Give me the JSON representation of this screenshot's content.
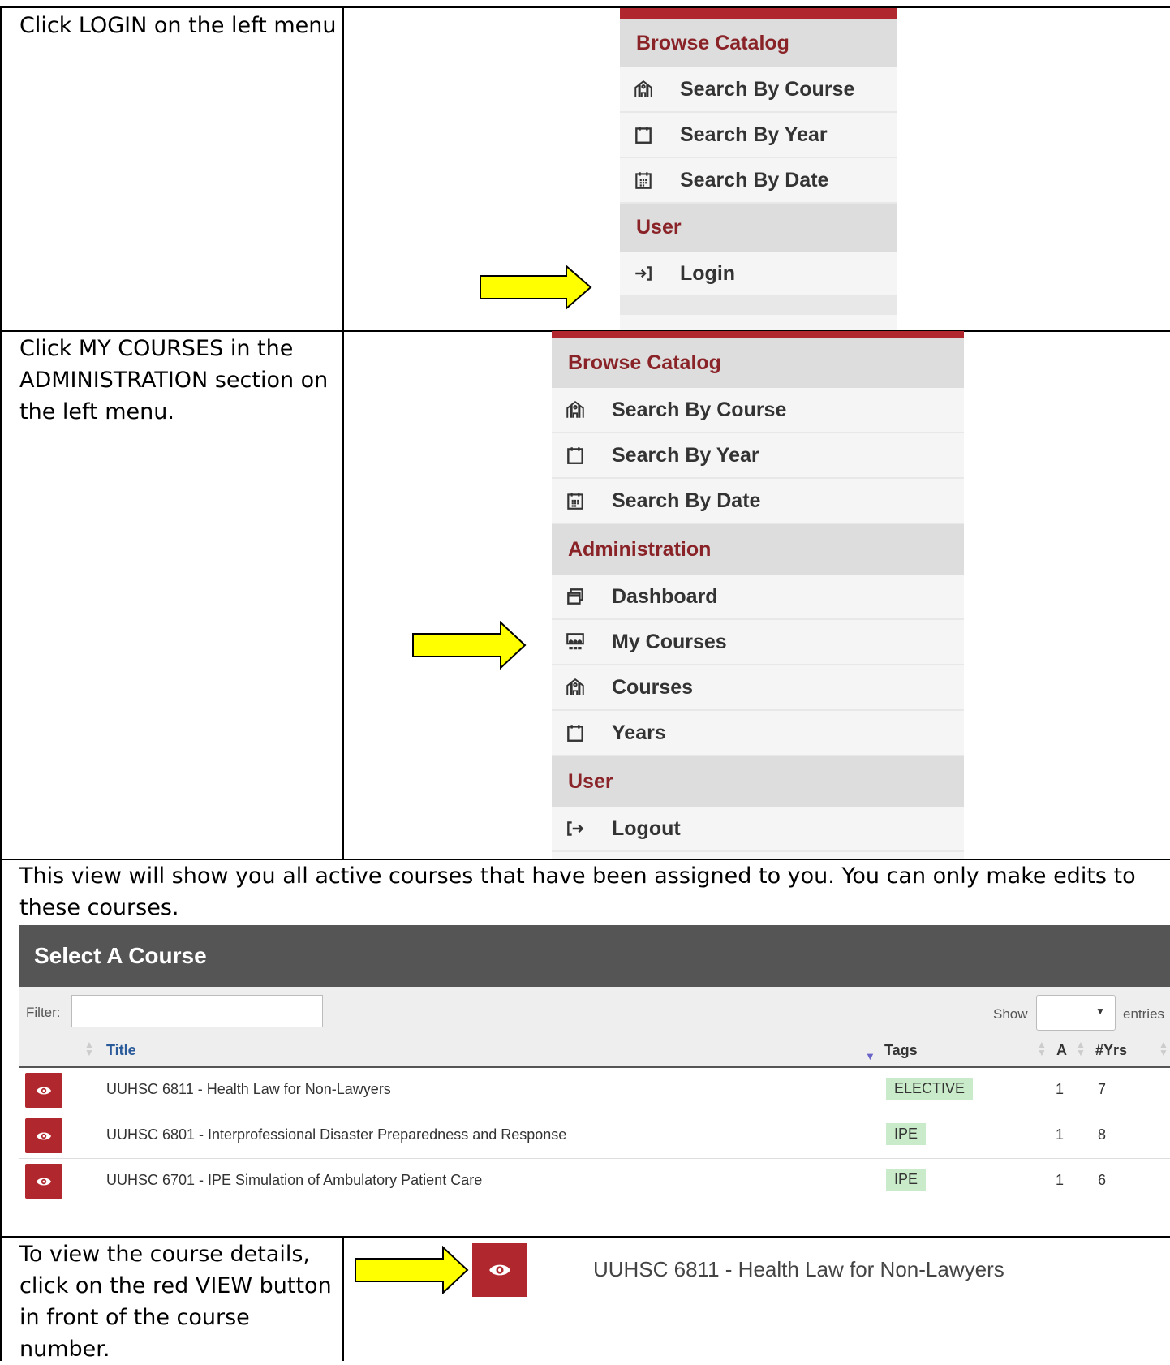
{
  "rows": [
    {
      "instruction": "Click LOGIN on the left menu"
    },
    {
      "instruction": "Click MY COURSES in the ADMINISTRATION section on the left menu."
    },
    {
      "instruction": "This view will show you all active courses that have been assigned to you. You can only make edits to these courses."
    },
    {
      "instruction": "To view the course details, click on the red VIEW button in front of the course number."
    }
  ],
  "menu1": {
    "browse_header": "Browse Catalog",
    "items": [
      "Search By Course",
      "Search By Year",
      "Search By Date"
    ],
    "item_icons": [
      "building-icon",
      "calendar-icon",
      "calendar-grid-icon"
    ],
    "user_header": "User",
    "login": "Login",
    "login_icon": "login-arrow-icon"
  },
  "menu2": {
    "browse_header": "Browse Catalog",
    "items": [
      "Search By Course",
      "Search By Year",
      "Search By Date"
    ],
    "admin_header": "Administration",
    "admin_items": [
      "Dashboard",
      "My Courses",
      "Courses",
      "Years"
    ],
    "admin_icons": [
      "windows-icon",
      "classroom-icon",
      "building-icon",
      "calendar-icon"
    ],
    "user_header": "User",
    "logout": "Logout",
    "logout_icon": "logout-arrow-icon"
  },
  "course_table": {
    "title": "Select A Course",
    "filter_label": "Filter:",
    "show_label": "Show",
    "entries_label": "entries",
    "columns": [
      "Title",
      "Tags",
      "A",
      "#Yrs"
    ],
    "rows": [
      {
        "title": "UUHSC 6811 - Health Law for Non-Lawyers",
        "tag": "ELECTIVE",
        "a": "1",
        "yrs": "7"
      },
      {
        "title": "UUHSC 6801 - Interprofessional Disaster Preparedness and Response",
        "tag": "IPE",
        "a": "1",
        "yrs": "8"
      },
      {
        "title": "UUHSC 6701 - IPE Simulation of Ambulatory Patient Care",
        "tag": "IPE",
        "a": "1",
        "yrs": "6"
      }
    ]
  },
  "zoom": {
    "title": "UUHSC 6811 - Health Law for Non-Lawyers"
  },
  "colors": {
    "accent_red": "#b0272d",
    "header_gray": "#555555",
    "arrow_yellow": "#ffff00",
    "tag_green": "#c9ebc9"
  }
}
